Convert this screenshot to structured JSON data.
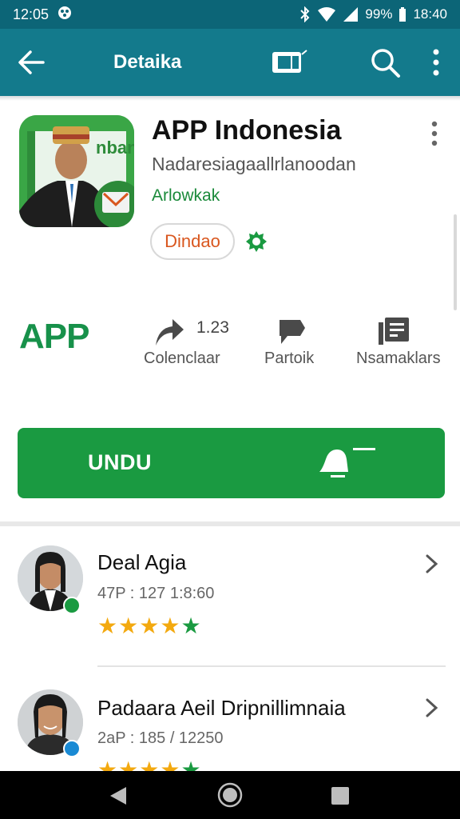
{
  "status_bar": {
    "time_left": "12:05",
    "battery": "99%",
    "time_right": "18:40"
  },
  "app_bar": {
    "title": "Detaika",
    "icons": [
      "back-arrow-icon",
      "cast-icon",
      "search-icon",
      "more-vert-icon"
    ]
  },
  "app": {
    "name": "APP Indonesia",
    "developer": "Nadaresiagaallrlanoodan",
    "category": "Arlowkak",
    "badge": "Dindao",
    "icon_text": "nban"
  },
  "stats": {
    "logo": "APP",
    "items": [
      {
        "number": "1.23",
        "label": "Colenclaar",
        "icon": "share-icon"
      },
      {
        "label": "Partoik",
        "icon": "flag-icon"
      },
      {
        "label": "Nsamaklars",
        "icon": "library-icon"
      }
    ]
  },
  "install": {
    "label": "UNDU",
    "icon": "bell-icon"
  },
  "reviews": [
    {
      "name": "Deal Agia",
      "date": "47P : 127 1:8:60",
      "stars": 5,
      "verified_color": "#1a9a41"
    },
    {
      "name": "Padaara Aeil Dripnillimnaia",
      "date": "2aP : 185 / 12250",
      "stars": 5,
      "verified_color": "#1a8ad4"
    }
  ],
  "colors": {
    "status_bar": "#0c6577",
    "app_bar": "#137a8c",
    "accent_green": "#1a9a41",
    "badge_text": "#d9571f",
    "star_gold": "#f3a90f"
  }
}
